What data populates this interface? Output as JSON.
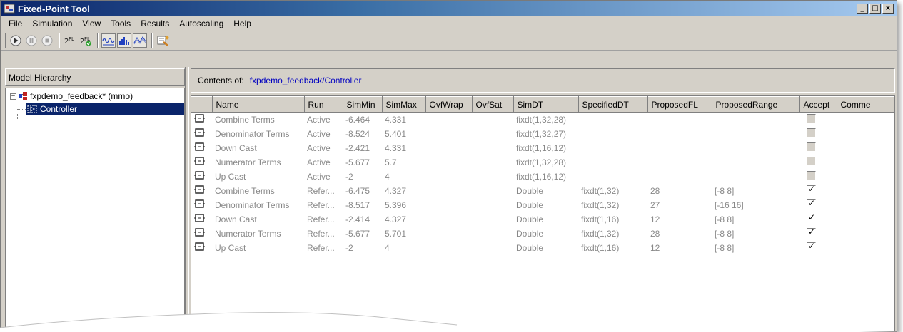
{
  "window": {
    "title": "Fixed-Point Tool",
    "controls": [
      "_",
      "□",
      "×"
    ]
  },
  "menu": [
    "File",
    "Simulation",
    "View",
    "Tools",
    "Results",
    "Autoscaling",
    "Help"
  ],
  "toolbar": {
    "icons": [
      "start-simulation-icon",
      "pause-simulation-icon",
      "stop-simulation-icon",
      "propose-fraction-lengths-icon",
      "apply-fraction-lengths-icon",
      "show-signal-icon",
      "show-histogram-icon",
      "show-difference-icon",
      "fixed-point-advisor-icon"
    ]
  },
  "hierarchy": {
    "header": "Model Hierarchy",
    "root": "fxpdemo_feedback* (mmo)",
    "child": "Controller",
    "root_expander": "−"
  },
  "contents": {
    "label": "Contents of:",
    "path": "fxpdemo_feedback/Controller"
  },
  "grid": {
    "columns": [
      "",
      "Name",
      "Run",
      "SimMin",
      "SimMax",
      "OvfWrap",
      "OvfSat",
      "SimDT",
      "SpecifiedDT",
      "ProposedFL",
      "ProposedRange",
      "Accept",
      "Comme"
    ],
    "rows": [
      {
        "name": "Combine Terms",
        "run": "Active",
        "simmin": "-6.464",
        "simmax": "4.331",
        "ovfwrap": "",
        "ovfsat": "",
        "simdt": "fixdt(1,32,28)",
        "specdt": "",
        "propfl": "",
        "range": "",
        "accept": false,
        "enabled": false
      },
      {
        "name": "Denominator Terms",
        "run": "Active",
        "simmin": "-8.524",
        "simmax": "5.401",
        "ovfwrap": "",
        "ovfsat": "",
        "simdt": "fixdt(1,32,27)",
        "specdt": "",
        "propfl": "",
        "range": "",
        "accept": false,
        "enabled": false
      },
      {
        "name": "Down Cast",
        "run": "Active",
        "simmin": "-2.421",
        "simmax": "4.331",
        "ovfwrap": "",
        "ovfsat": "",
        "simdt": "fixdt(1,16,12)",
        "specdt": "",
        "propfl": "",
        "range": "",
        "accept": false,
        "enabled": false
      },
      {
        "name": "Numerator Terms",
        "run": "Active",
        "simmin": "-5.677",
        "simmax": "5.7",
        "ovfwrap": "",
        "ovfsat": "",
        "simdt": "fixdt(1,32,28)",
        "specdt": "",
        "propfl": "",
        "range": "",
        "accept": false,
        "enabled": false
      },
      {
        "name": "Up Cast",
        "run": "Active",
        "simmin": "-2",
        "simmax": "4",
        "ovfwrap": "",
        "ovfsat": "",
        "simdt": "fixdt(1,16,12)",
        "specdt": "",
        "propfl": "",
        "range": "",
        "accept": false,
        "enabled": false
      },
      {
        "name": "Combine Terms",
        "run": "Refer...",
        "simmin": "-6.475",
        "simmax": "4.327",
        "ovfwrap": "",
        "ovfsat": "",
        "simdt": "Double",
        "specdt": "fixdt(1,32)",
        "propfl": "28",
        "range": "[-8 8]",
        "accept": true,
        "enabled": true
      },
      {
        "name": "Denominator Terms",
        "run": "Refer...",
        "simmin": "-8.517",
        "simmax": "5.396",
        "ovfwrap": "",
        "ovfsat": "",
        "simdt": "Double",
        "specdt": "fixdt(1,32)",
        "propfl": "27",
        "range": "[-16 16]",
        "accept": true,
        "enabled": true
      },
      {
        "name": "Down Cast",
        "run": "Refer...",
        "simmin": "-2.414",
        "simmax": "4.327",
        "ovfwrap": "",
        "ovfsat": "",
        "simdt": "Double",
        "specdt": "fixdt(1,16)",
        "propfl": "12",
        "range": "[-8 8]",
        "accept": true,
        "enabled": true
      },
      {
        "name": "Numerator Terms",
        "run": "Refer...",
        "simmin": "-5.677",
        "simmax": "5.701",
        "ovfwrap": "",
        "ovfsat": "",
        "simdt": "Double",
        "specdt": "fixdt(1,32)",
        "propfl": "28",
        "range": "[-8 8]",
        "accept": true,
        "enabled": true
      },
      {
        "name": "Up Cast",
        "run": "Refer...",
        "simmin": "-2",
        "simmax": "4",
        "ovfwrap": "",
        "ovfsat": "",
        "simdt": "Double",
        "specdt": "fixdt(1,16)",
        "propfl": "12",
        "range": "[-8 8]",
        "accept": true,
        "enabled": true
      }
    ]
  },
  "colors": {
    "title_gradient_start": "#0a246a",
    "title_gradient_end": "#a6caf0",
    "selection": "#0a246a",
    "path_link": "#0000c0",
    "chrome": "#d4d0c8"
  }
}
